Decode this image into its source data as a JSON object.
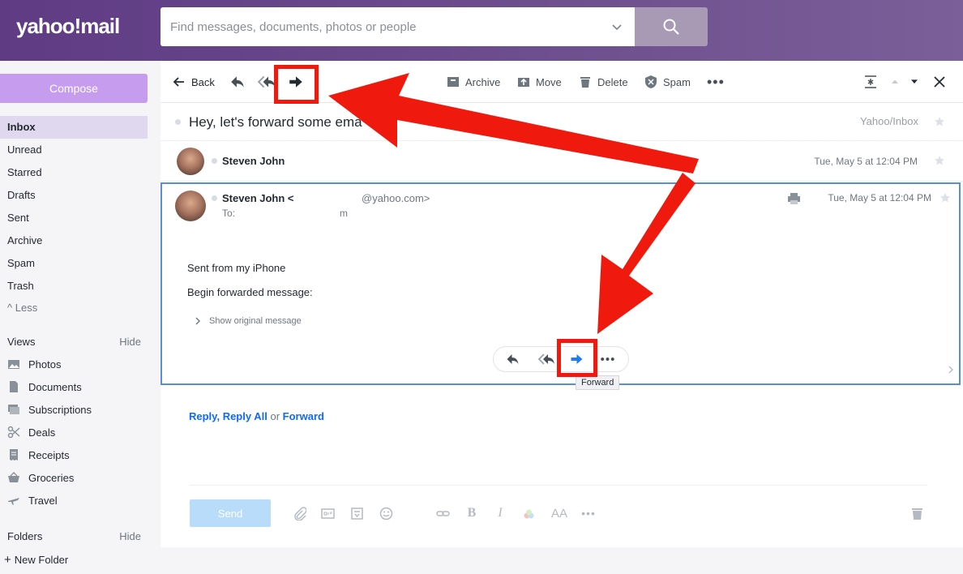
{
  "header": {
    "logo": "yahoo!mail",
    "search_placeholder": "Find messages, documents, photos or people"
  },
  "sidebar": {
    "compose": "Compose",
    "folders": [
      "Inbox",
      "Unread",
      "Starred",
      "Drafts",
      "Sent",
      "Archive",
      "Spam",
      "Trash"
    ],
    "less": "Less",
    "views_label": "Views",
    "views_hide": "Hide",
    "views": [
      "Photos",
      "Documents",
      "Subscriptions",
      "Deals",
      "Receipts",
      "Groceries",
      "Travel"
    ],
    "folders_label": "Folders",
    "folders_hide": "Hide",
    "new_folder": "New Folder"
  },
  "toolbar": {
    "back": "Back",
    "archive": "Archive",
    "move": "Move",
    "delete": "Delete",
    "spam": "Spam"
  },
  "thread": {
    "subject": "Hey, let's forward some ema",
    "folder_path": "Yahoo/Inbox",
    "messages": [
      {
        "sender": "Steven John",
        "date": "Tue, May 5 at 12:04 PM"
      },
      {
        "sender": "Steven John <",
        "email": "@yahoo.com>",
        "to_label": "To: ",
        "to_value": "m",
        "date": "Tue, May 5 at 12:04 PM"
      }
    ],
    "body": [
      "Sent from my iPhone",
      "Begin forwarded message:"
    ],
    "show_original": "Show original message",
    "tooltip": "Forward"
  },
  "reply_area": {
    "reply": "Reply",
    "reply_all": "Reply All",
    "or": "or",
    "forward": "Forward",
    "comma": ",",
    "send": "Send"
  },
  "colors": {
    "highlight": "#f0190e",
    "link": "#0f69ff",
    "compose": "#c69cee"
  }
}
